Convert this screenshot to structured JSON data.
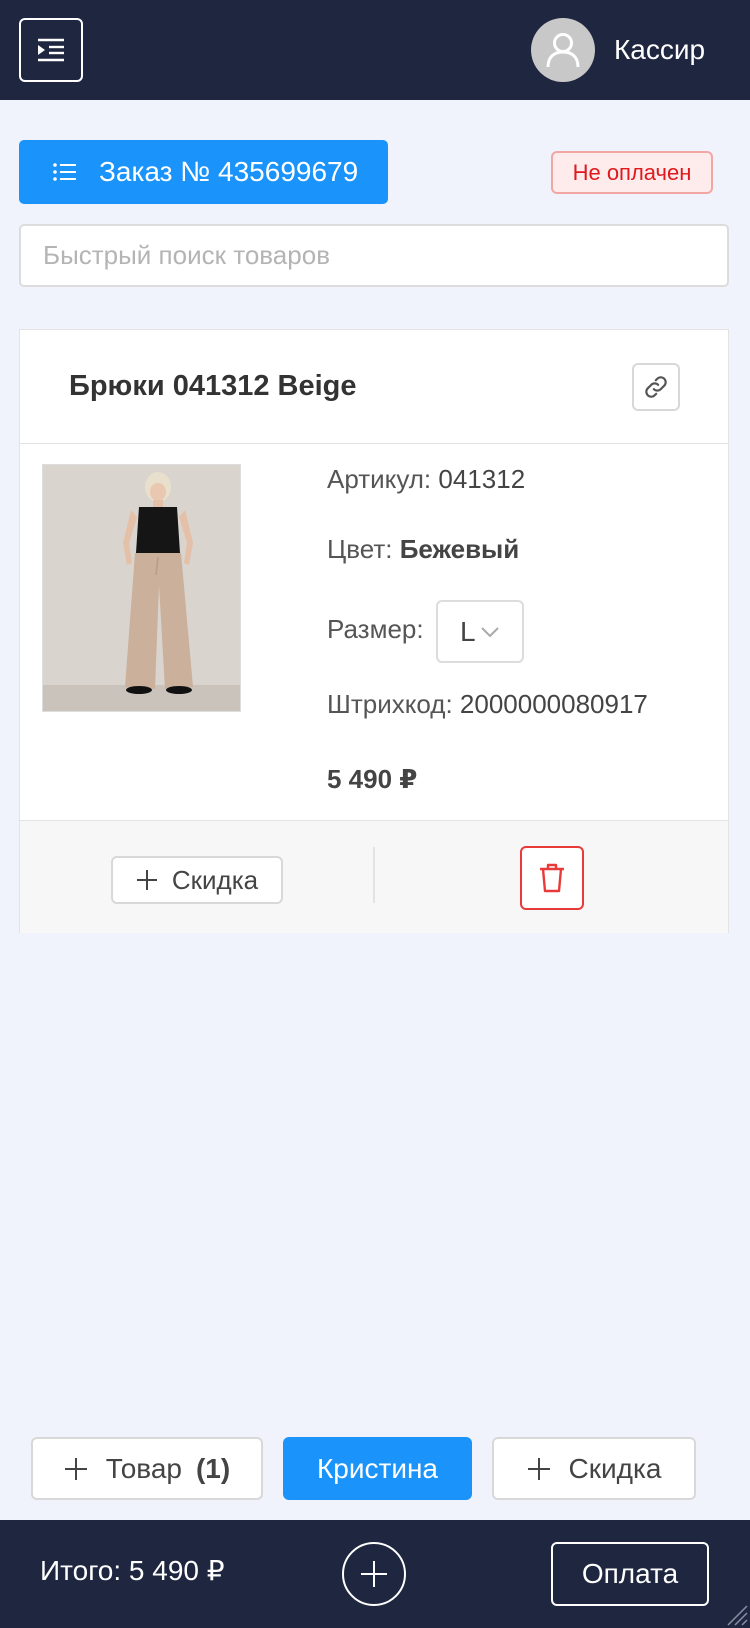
{
  "header": {
    "user_name": "Кассир",
    "icons": {
      "menu": "menu-indent-icon",
      "avatar": "user-icon"
    }
  },
  "order": {
    "label": "Заказ № 435699679",
    "status": "Не оплачен",
    "status_color": "#e0191d"
  },
  "search": {
    "placeholder": "Быстрый поиск товаров",
    "value": ""
  },
  "product": {
    "title": "Брюки 041312 Beige",
    "article_label": "Артикул:",
    "article_value": "041312",
    "color_label": "Цвет:",
    "color_value": "Бежевый",
    "size_label": "Размер:",
    "size_value": "L",
    "barcode_label": "Штрихкод:",
    "barcode_value": "2000000080917",
    "price": "5 490 ₽",
    "discount_label": "Скидка",
    "icons": {
      "link": "link-icon",
      "delete": "trash-icon"
    }
  },
  "actions": {
    "add_product_label": "Товар",
    "add_product_count": "(1)",
    "seller_label": "Кристина",
    "add_discount_label": "Скидка"
  },
  "footer": {
    "total": "Итого: 5 490 ₽",
    "pay_label": "Оплата"
  },
  "colors": {
    "primary": "#1a93fb",
    "dark_bg": "#1f2640",
    "page_bg": "#f0f3fc",
    "danger": "#e93a3a"
  }
}
